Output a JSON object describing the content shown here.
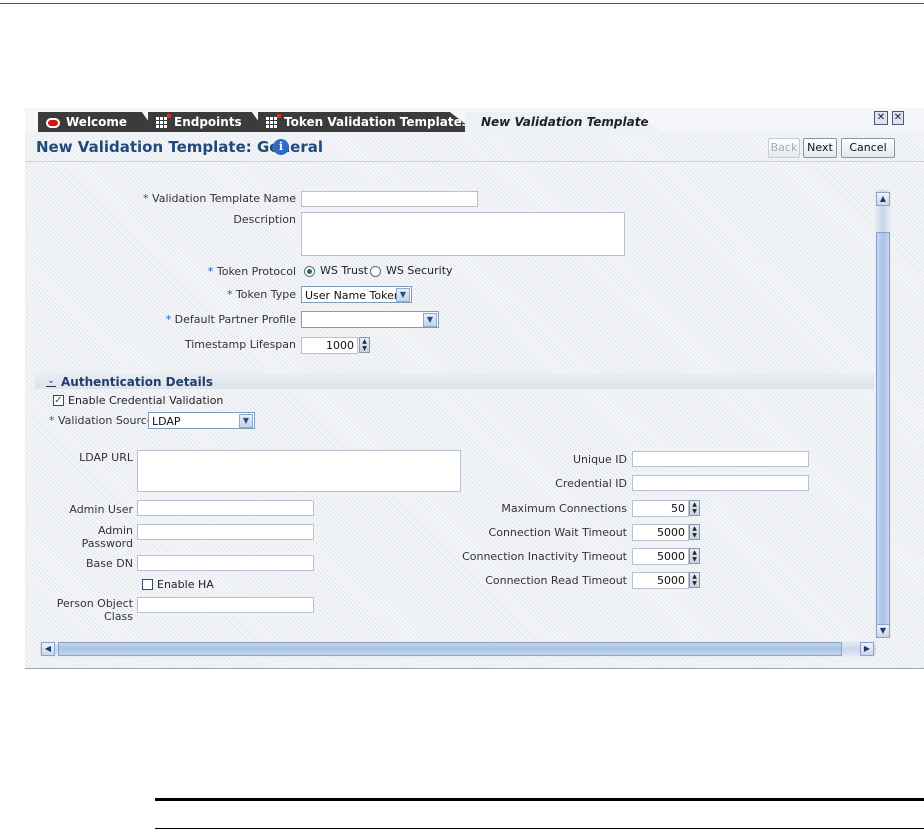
{
  "tabs": [
    {
      "label": "Welcome",
      "icon": "oracle-icon"
    },
    {
      "label": "Endpoints",
      "icon": "grid-icon"
    },
    {
      "label": "Token Validation Templates",
      "icon": "grid-icon"
    },
    {
      "label": "New Validation Template",
      "active": true
    }
  ],
  "header": {
    "title": "New Validation Template: General",
    "info_icon": "i",
    "back_label": "Back",
    "next_label": "Next",
    "cancel_label": "Cancel"
  },
  "general": {
    "name_label": "Validation Template Name",
    "name_value": "",
    "description_label": "Description",
    "description_value": "",
    "protocol_label": "Token Protocol",
    "protocol_options": [
      "WS Trust",
      "WS Security"
    ],
    "protocol_selected": "WS Trust",
    "token_type_label": "Token Type",
    "token_type_value": "User Name Token",
    "partner_profile_label": "Default Partner Profile",
    "partner_profile_value": "",
    "timestamp_label": "Timestamp Lifespan",
    "timestamp_value": "1000"
  },
  "auth": {
    "section_title": "Authentication Details",
    "enable_credential_label": "Enable Credential Validation",
    "enable_credential_checked": true,
    "validation_source_label": "Validation Source",
    "validation_source_value": "LDAP",
    "ldap_url_label": "LDAP URL",
    "ldap_url_value": "",
    "admin_user_label": "Admin User",
    "admin_user_value": "",
    "admin_password_label_1": "Admin",
    "admin_password_label_2": "Password",
    "admin_password_value": "",
    "base_dn_label": "Base DN",
    "base_dn_value": "",
    "enable_ha_label": "Enable HA",
    "enable_ha_checked": false,
    "person_class_label_1": "Person Object",
    "person_class_label_2": "Class",
    "person_class_value": "",
    "unique_id_label": "Unique ID",
    "unique_id_value": "",
    "credential_id_label": "Credential ID",
    "credential_id_value": "",
    "max_conn_label": "Maximum Connections",
    "max_conn_value": "50",
    "wait_timeout_label": "Connection Wait Timeout",
    "wait_timeout_value": "5000",
    "inactivity_timeout_label": "Connection Inactivity Timeout",
    "inactivity_timeout_value": "5000",
    "read_timeout_label": "Connection Read Timeout",
    "read_timeout_value": "5000"
  },
  "required_marker": "*",
  "colors": {
    "title": "#1f4a7a",
    "tab_dark": "#3b3b3b",
    "accent": "#2e6dc5"
  }
}
